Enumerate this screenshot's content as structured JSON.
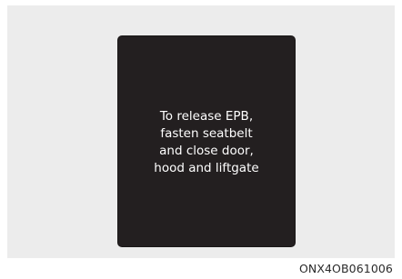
{
  "display": {
    "message_lines": [
      "To release EPB,",
      "fasten seatbelt",
      "and close door,",
      "hood and liftgate"
    ]
  },
  "figure": {
    "code": "ONX4OB061006"
  },
  "colors": {
    "background_panel": "#ececec",
    "display_screen": "#231f20",
    "display_text": "#ffffff"
  }
}
